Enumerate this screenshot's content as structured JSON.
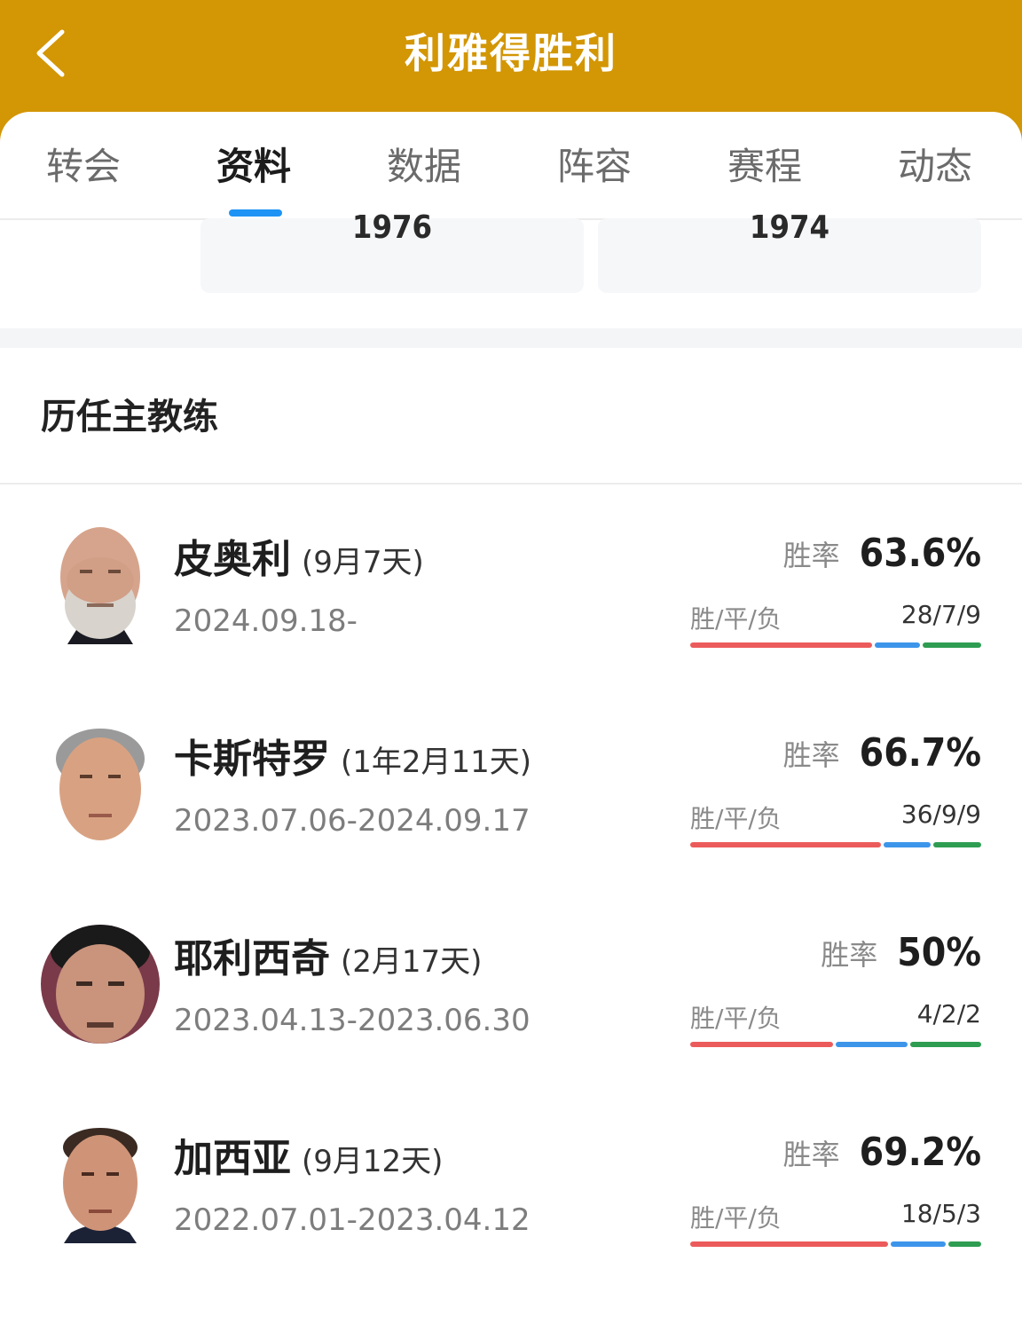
{
  "header": {
    "title": "利雅得胜利",
    "back_icon": "chevron-left-icon"
  },
  "tabs": [
    {
      "label": "转会"
    },
    {
      "label": "资料",
      "active": true
    },
    {
      "label": "数据"
    },
    {
      "label": "阵容"
    },
    {
      "label": "赛程"
    },
    {
      "label": "动态"
    }
  ],
  "info_cards": [
    {
      "value": "1976"
    },
    {
      "value": "1974"
    }
  ],
  "section": {
    "title": "历任主教练"
  },
  "colors": {
    "header": "#d39604",
    "accent": "#1e93f5",
    "win": "#ec5b5b",
    "draw": "#3d95ea",
    "loss": "#2e9d52"
  },
  "coaches": [
    {
      "name": "皮奥利",
      "tenure": "(9月7天)",
      "dates": "2024.09.18-",
      "rate_label": "胜率",
      "rate": "63.6%",
      "wdl_label": "胜/平/负",
      "wdl": "28/7/9",
      "w": 28,
      "d": 7,
      "l": 9
    },
    {
      "name": "卡斯特罗",
      "tenure": "(1年2月11天)",
      "dates": "2023.07.06-2024.09.17",
      "rate_label": "胜率",
      "rate": "66.7%",
      "wdl_label": "胜/平/负",
      "wdl": "36/9/9",
      "w": 36,
      "d": 9,
      "l": 9
    },
    {
      "name": "耶利西奇",
      "tenure": "(2月17天)",
      "dates": "2023.04.13-2023.06.30",
      "rate_label": "胜率",
      "rate": "50%",
      "wdl_label": "胜/平/负",
      "wdl": "4/2/2",
      "w": 4,
      "d": 2,
      "l": 2
    },
    {
      "name": "加西亚",
      "tenure": "(9月12天)",
      "dates": "2022.07.01-2023.04.12",
      "rate_label": "胜率",
      "rate": "69.2%",
      "wdl_label": "胜/平/负",
      "wdl": "18/5/3",
      "w": 18,
      "d": 5,
      "l": 3
    }
  ]
}
